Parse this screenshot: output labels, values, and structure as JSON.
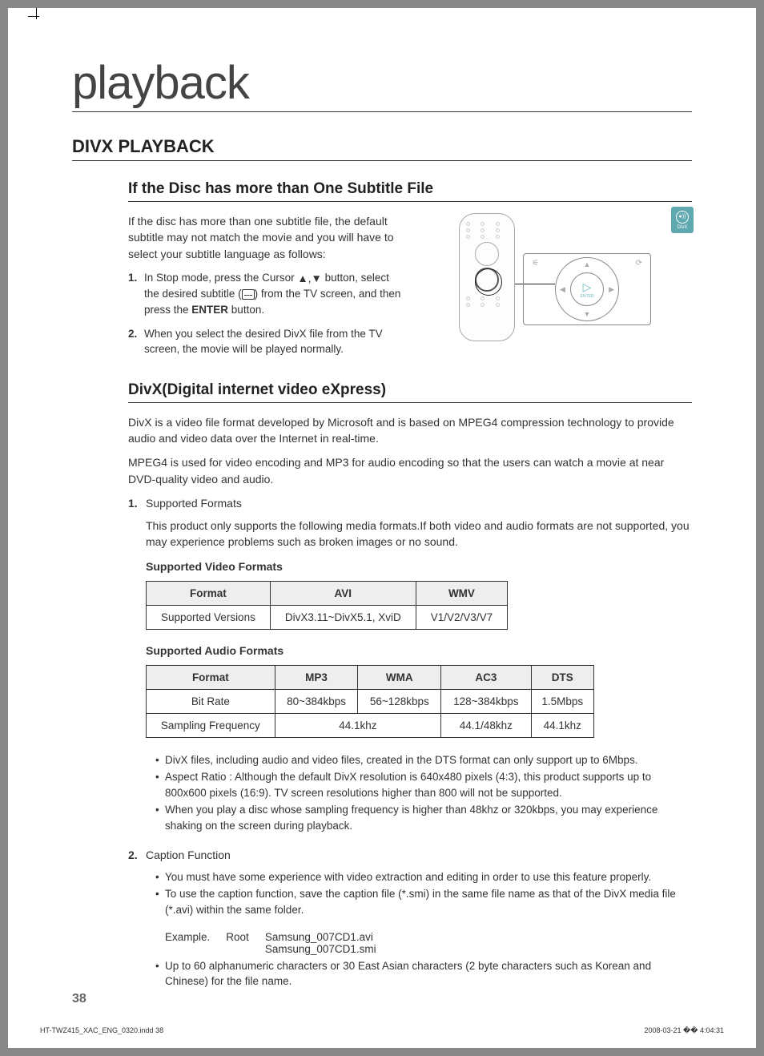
{
  "page_title": "playback",
  "section_heading": "DIVX PLAYBACK",
  "badge": {
    "label": "DivX"
  },
  "subtitle_section": {
    "heading": "If the Disc has more than One Subtitle File",
    "intro": "If the disc has more than one subtitle file, the default subtitle may not match the movie and you will have to select your subtitle language as follows:",
    "step1_a": "In Stop mode, press the Cursor ",
    "step1_b": " button, select the desired subtitle (",
    "step1_c": ") from the TV screen, and then press the ",
    "step1_enter": "ENTER",
    "step1_d": " button.",
    "step2": "When you select the desired DivX file from the TV screen, the movie will be played normally."
  },
  "dpad": {
    "enter": "ENTER"
  },
  "divx_section": {
    "heading": "DivX(Digital internet video eXpress)",
    "p1": "DivX is a video file format developed by Microsoft and is based on MPEG4 compression technology to provide audio and video data over the Internet in real-time.",
    "p2": "MPEG4 is used for video encoding and MP3 for audio encoding so that the users can watch a movie at near DVD-quality video and audio.",
    "sf_label_num": "1.",
    "sf_label": "Supported Formats",
    "sf_body": "This product only supports the following media formats.If both video and audio formats are not supported, you may experience problems such as broken images or no sound.",
    "video_caption": "Supported Video Formats",
    "audio_caption": "Supported Audio Formats",
    "cap_label_num": "2.",
    "cap_label": "Caption Function"
  },
  "video_table": {
    "h1": "Format",
    "h2": "AVI",
    "h3": "WMV",
    "r1c1": "Supported Versions",
    "r1c2": "DivX3.11~DivX5.1, XviD",
    "r1c3": "V1/V2/V3/V7"
  },
  "audio_table": {
    "h1": "Format",
    "h2": "MP3",
    "h3": "WMA",
    "h4": "AC3",
    "h5": "DTS",
    "r1c1": "Bit Rate",
    "r1c2": "80~384kbps",
    "r1c3": "56~128kbps",
    "r1c4": "128~384kbps",
    "r1c5": "1.5Mbps",
    "r2c1": "Sampling Frequency",
    "r2c2": "44.1khz",
    "r2c4": "44.1/48khz",
    "r2c5": "44.1khz"
  },
  "notes": {
    "n1": "DivX files, including audio and video files, created in the DTS format can only support up to 6Mbps.",
    "n2": "Aspect Ratio : Although the default DivX resolution is 640x480 pixels (4:3), this product supports up to 800x600 pixels (16:9). TV screen resolutions higher than 800 will not be supported.",
    "n3": "When you play a disc whose sampling frequency is higher than 48khz or 320kbps, you may experience shaking on the screen during playback."
  },
  "caption_notes": {
    "c1": "You must have some experience with video extraction and editing in order to use this feature properly.",
    "c2": "To use the caption function, save the caption file (*.smi) in the same file name as that of the DivX media file (*.avi) within the same folder.",
    "ex_label": "Example.",
    "ex_root": "Root",
    "ex_file1": "Samsung_007CD1.avi",
    "ex_file2": "Samsung_007CD1.smi",
    "c3": "Up to 60 alphanumeric characters or 30 East Asian characters (2 byte characters such as Korean and Chinese) for the file name."
  },
  "page_number": "38",
  "footer": {
    "left": "HT-TWZ415_XAC_ENG_0320.indd   38",
    "right": "2008-03-21   �� 4:04:31"
  }
}
